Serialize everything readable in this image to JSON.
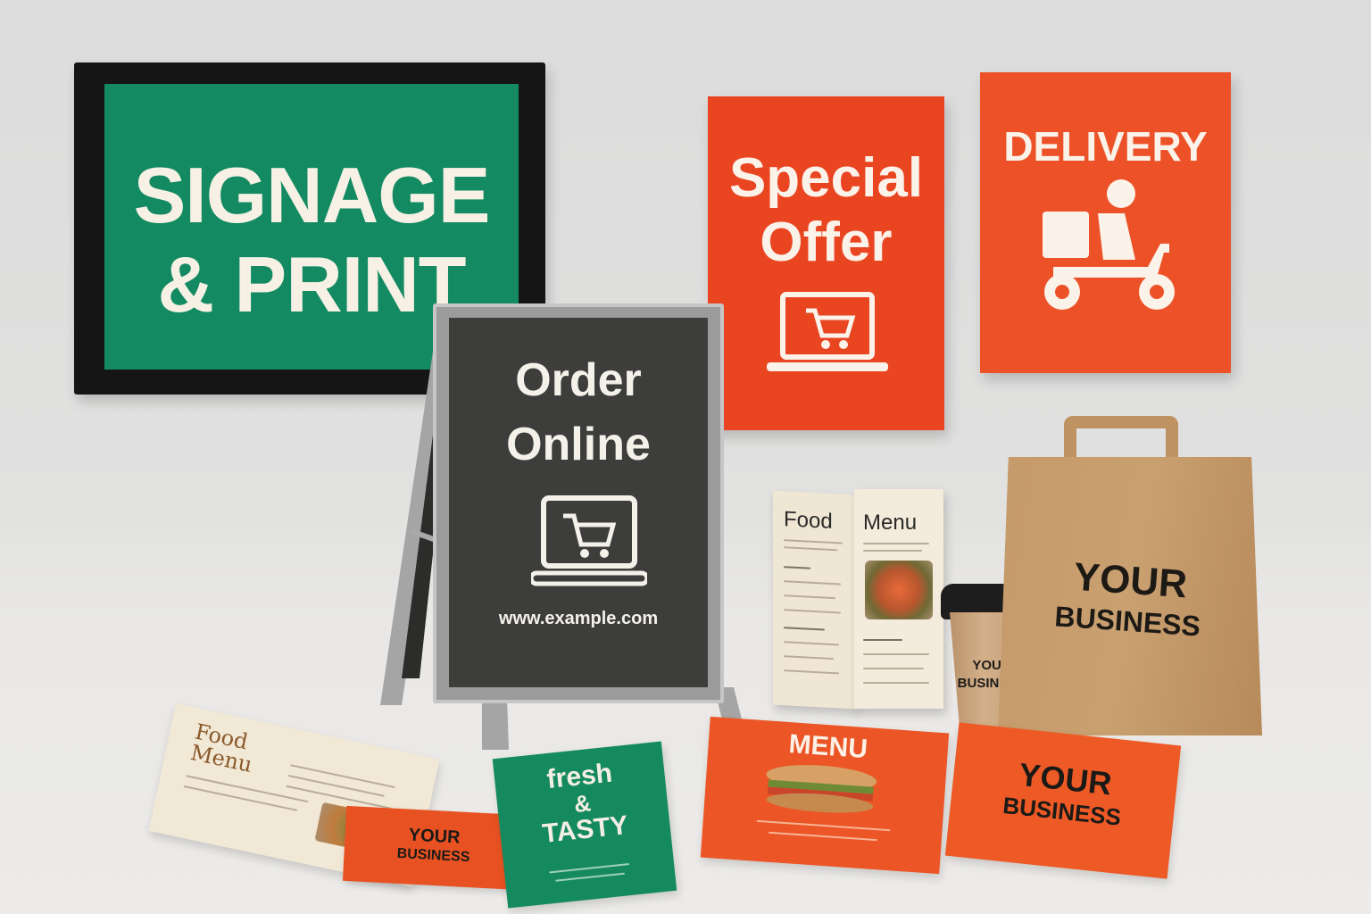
{
  "signage": {
    "line1": "SIGNAGE",
    "line2": "& PRINT",
    "color": "#138a62"
  },
  "special_offer": {
    "line1": "Special",
    "line2": "Offer",
    "icon": "laptop-cart-icon",
    "color": "#ea4521"
  },
  "delivery": {
    "title": "DELIVERY",
    "icon": "delivery-scooter-icon",
    "color": "#ec5127"
  },
  "sandwich_board": {
    "line1": "Order",
    "line2": "Online",
    "icon": "laptop-cart-icon",
    "url": "www.example.com"
  },
  "trifold_menu": {
    "left_heading": "Food",
    "right_heading": "Menu"
  },
  "cup": {
    "line1": "YOUR",
    "line2": "BUSINESS"
  },
  "bag": {
    "line1": "YOUR",
    "line2": "BUSINESS"
  },
  "food_flyer": {
    "line1": "Food",
    "line2": "Menu"
  },
  "small_card": {
    "line1": "YOUR",
    "line2": "BUSINESS"
  },
  "fresh_card": {
    "line1": "fresh",
    "line2": "&",
    "line3": "TASTY"
  },
  "menu_card": {
    "title": "MENU"
  },
  "large_card": {
    "line1": "YOUR",
    "line2": "BUSINESS"
  }
}
